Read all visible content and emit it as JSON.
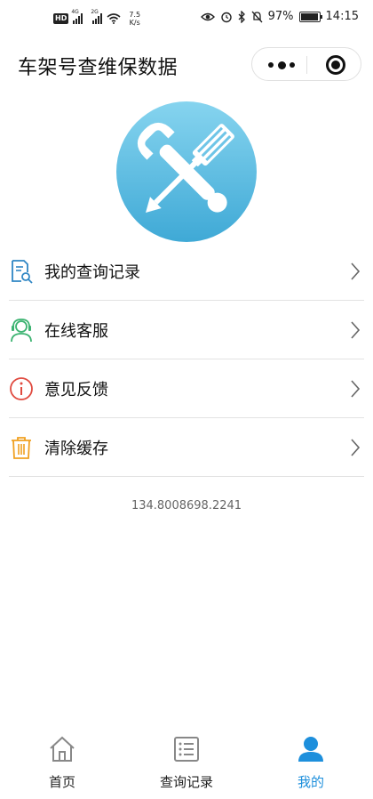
{
  "status_bar": {
    "network_1": "4G",
    "network_2": "2G",
    "speed_value": "7.5",
    "speed_unit": "K/s",
    "battery": "97%",
    "time": "14:15"
  },
  "header": {
    "title": "车架号查维保数据",
    "more_icon": "more-dots-icon",
    "close_icon": "target-circle-icon"
  },
  "logo": {
    "icon": "wrench-screwdriver-icon",
    "background_color": "#5bbfe0"
  },
  "menu": {
    "items": [
      {
        "label": "我的查询记录",
        "icon": "document-search-icon",
        "color": "#2f86c4"
      },
      {
        "label": "在线客服",
        "icon": "customer-service-icon",
        "color": "#3cb371"
      },
      {
        "label": "意见反馈",
        "icon": "info-circle-icon",
        "color": "#e04a3f"
      },
      {
        "label": "清除缓存",
        "icon": "trash-icon",
        "color": "#f0a020"
      }
    ]
  },
  "version": "134.8008698.2241",
  "tabbar": {
    "tabs": [
      {
        "label": "首页",
        "icon": "home-icon"
      },
      {
        "label": "查询记录",
        "icon": "list-icon"
      },
      {
        "label": "我的",
        "icon": "person-icon",
        "active": true
      }
    ],
    "active_color": "#1d8fdc"
  }
}
